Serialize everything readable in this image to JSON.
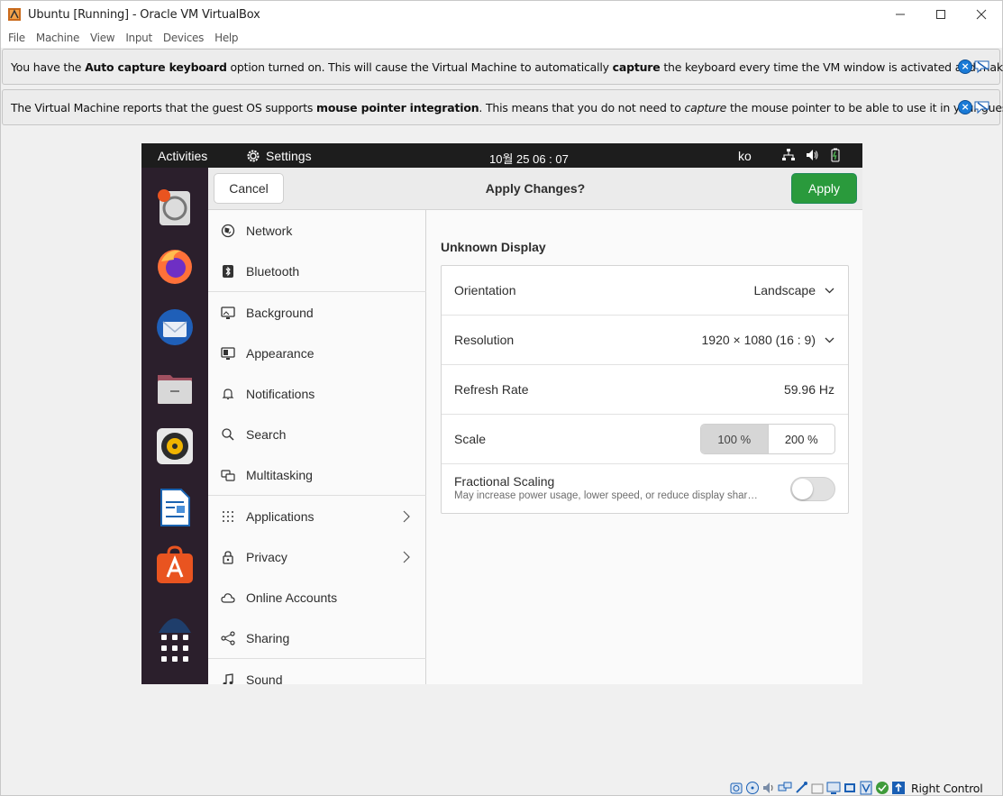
{
  "window": {
    "title": "Ubuntu [Running] - Oracle VM VirtualBox"
  },
  "menubar": {
    "items": [
      "File",
      "Machine",
      "View",
      "Input",
      "Devices",
      "Help"
    ]
  },
  "notices": [
    {
      "parts": [
        {
          "t": "You have the ",
          "b": false
        },
        {
          "t": "Auto capture keyboard",
          "b": true
        },
        {
          "t": " option turned on. This will cause the Virtual Machine to automatically ",
          "b": false
        },
        {
          "t": "capture",
          "b": true
        },
        {
          "t": " the keyboard every time the VM window is activated and make it",
          "b": false
        }
      ]
    },
    {
      "parts": [
        {
          "t": "The Virtual Machine reports that the guest OS supports ",
          "b": false
        },
        {
          "t": "mouse pointer integration",
          "b": true
        },
        {
          "t": ". This means that you do not need to ",
          "b": false
        },
        {
          "t": "capture",
          "i": true
        },
        {
          "t": " the mouse pointer to be able to use it in your guest",
          "b": false
        }
      ]
    }
  ],
  "gnome": {
    "activities": "Activities",
    "app_name": "Settings",
    "clock": "10월 25  06 : 07",
    "lang": "ko"
  },
  "header": {
    "cancel": "Cancel",
    "title": "Apply Changes?",
    "apply": "Apply"
  },
  "sidebar": {
    "items": [
      {
        "label": "Network",
        "icon": "network-icon"
      },
      {
        "label": "Bluetooth",
        "icon": "bluetooth-icon"
      },
      {
        "label": "Background",
        "icon": "background-icon"
      },
      {
        "label": "Appearance",
        "icon": "appearance-icon"
      },
      {
        "label": "Notifications",
        "icon": "bell-icon"
      },
      {
        "label": "Search",
        "icon": "search-icon"
      },
      {
        "label": "Multitasking",
        "icon": "multitasking-icon"
      },
      {
        "label": "Applications",
        "icon": "apps-grid-icon",
        "chevron": true
      },
      {
        "label": "Privacy",
        "icon": "lock-icon",
        "chevron": true
      },
      {
        "label": "Online Accounts",
        "icon": "cloud-icon"
      },
      {
        "label": "Sharing",
        "icon": "share-icon"
      },
      {
        "label": "Sound",
        "icon": "music-note-icon"
      }
    ]
  },
  "display": {
    "title": "Unknown Display",
    "orientation_label": "Orientation",
    "orientation_value": "Landscape",
    "resolution_label": "Resolution",
    "resolution_value": "1920 × 1080 (16 : 9)",
    "refresh_label": "Refresh Rate",
    "refresh_value": "59.96 Hz",
    "scale_label": "Scale",
    "scale_options": [
      "100 %",
      "200 %"
    ],
    "scale_selected": "100 %",
    "fractional_label": "Fractional Scaling",
    "fractional_desc": "May increase power usage, lower speed, or reduce display shar…",
    "fractional_on": false
  },
  "statusbar": {
    "host_key": "Right Control"
  },
  "colors": {
    "apply_green": "#2a9a3c",
    "dock_bg": "#2b1f2c",
    "topbar_bg": "#1d1d1d"
  }
}
